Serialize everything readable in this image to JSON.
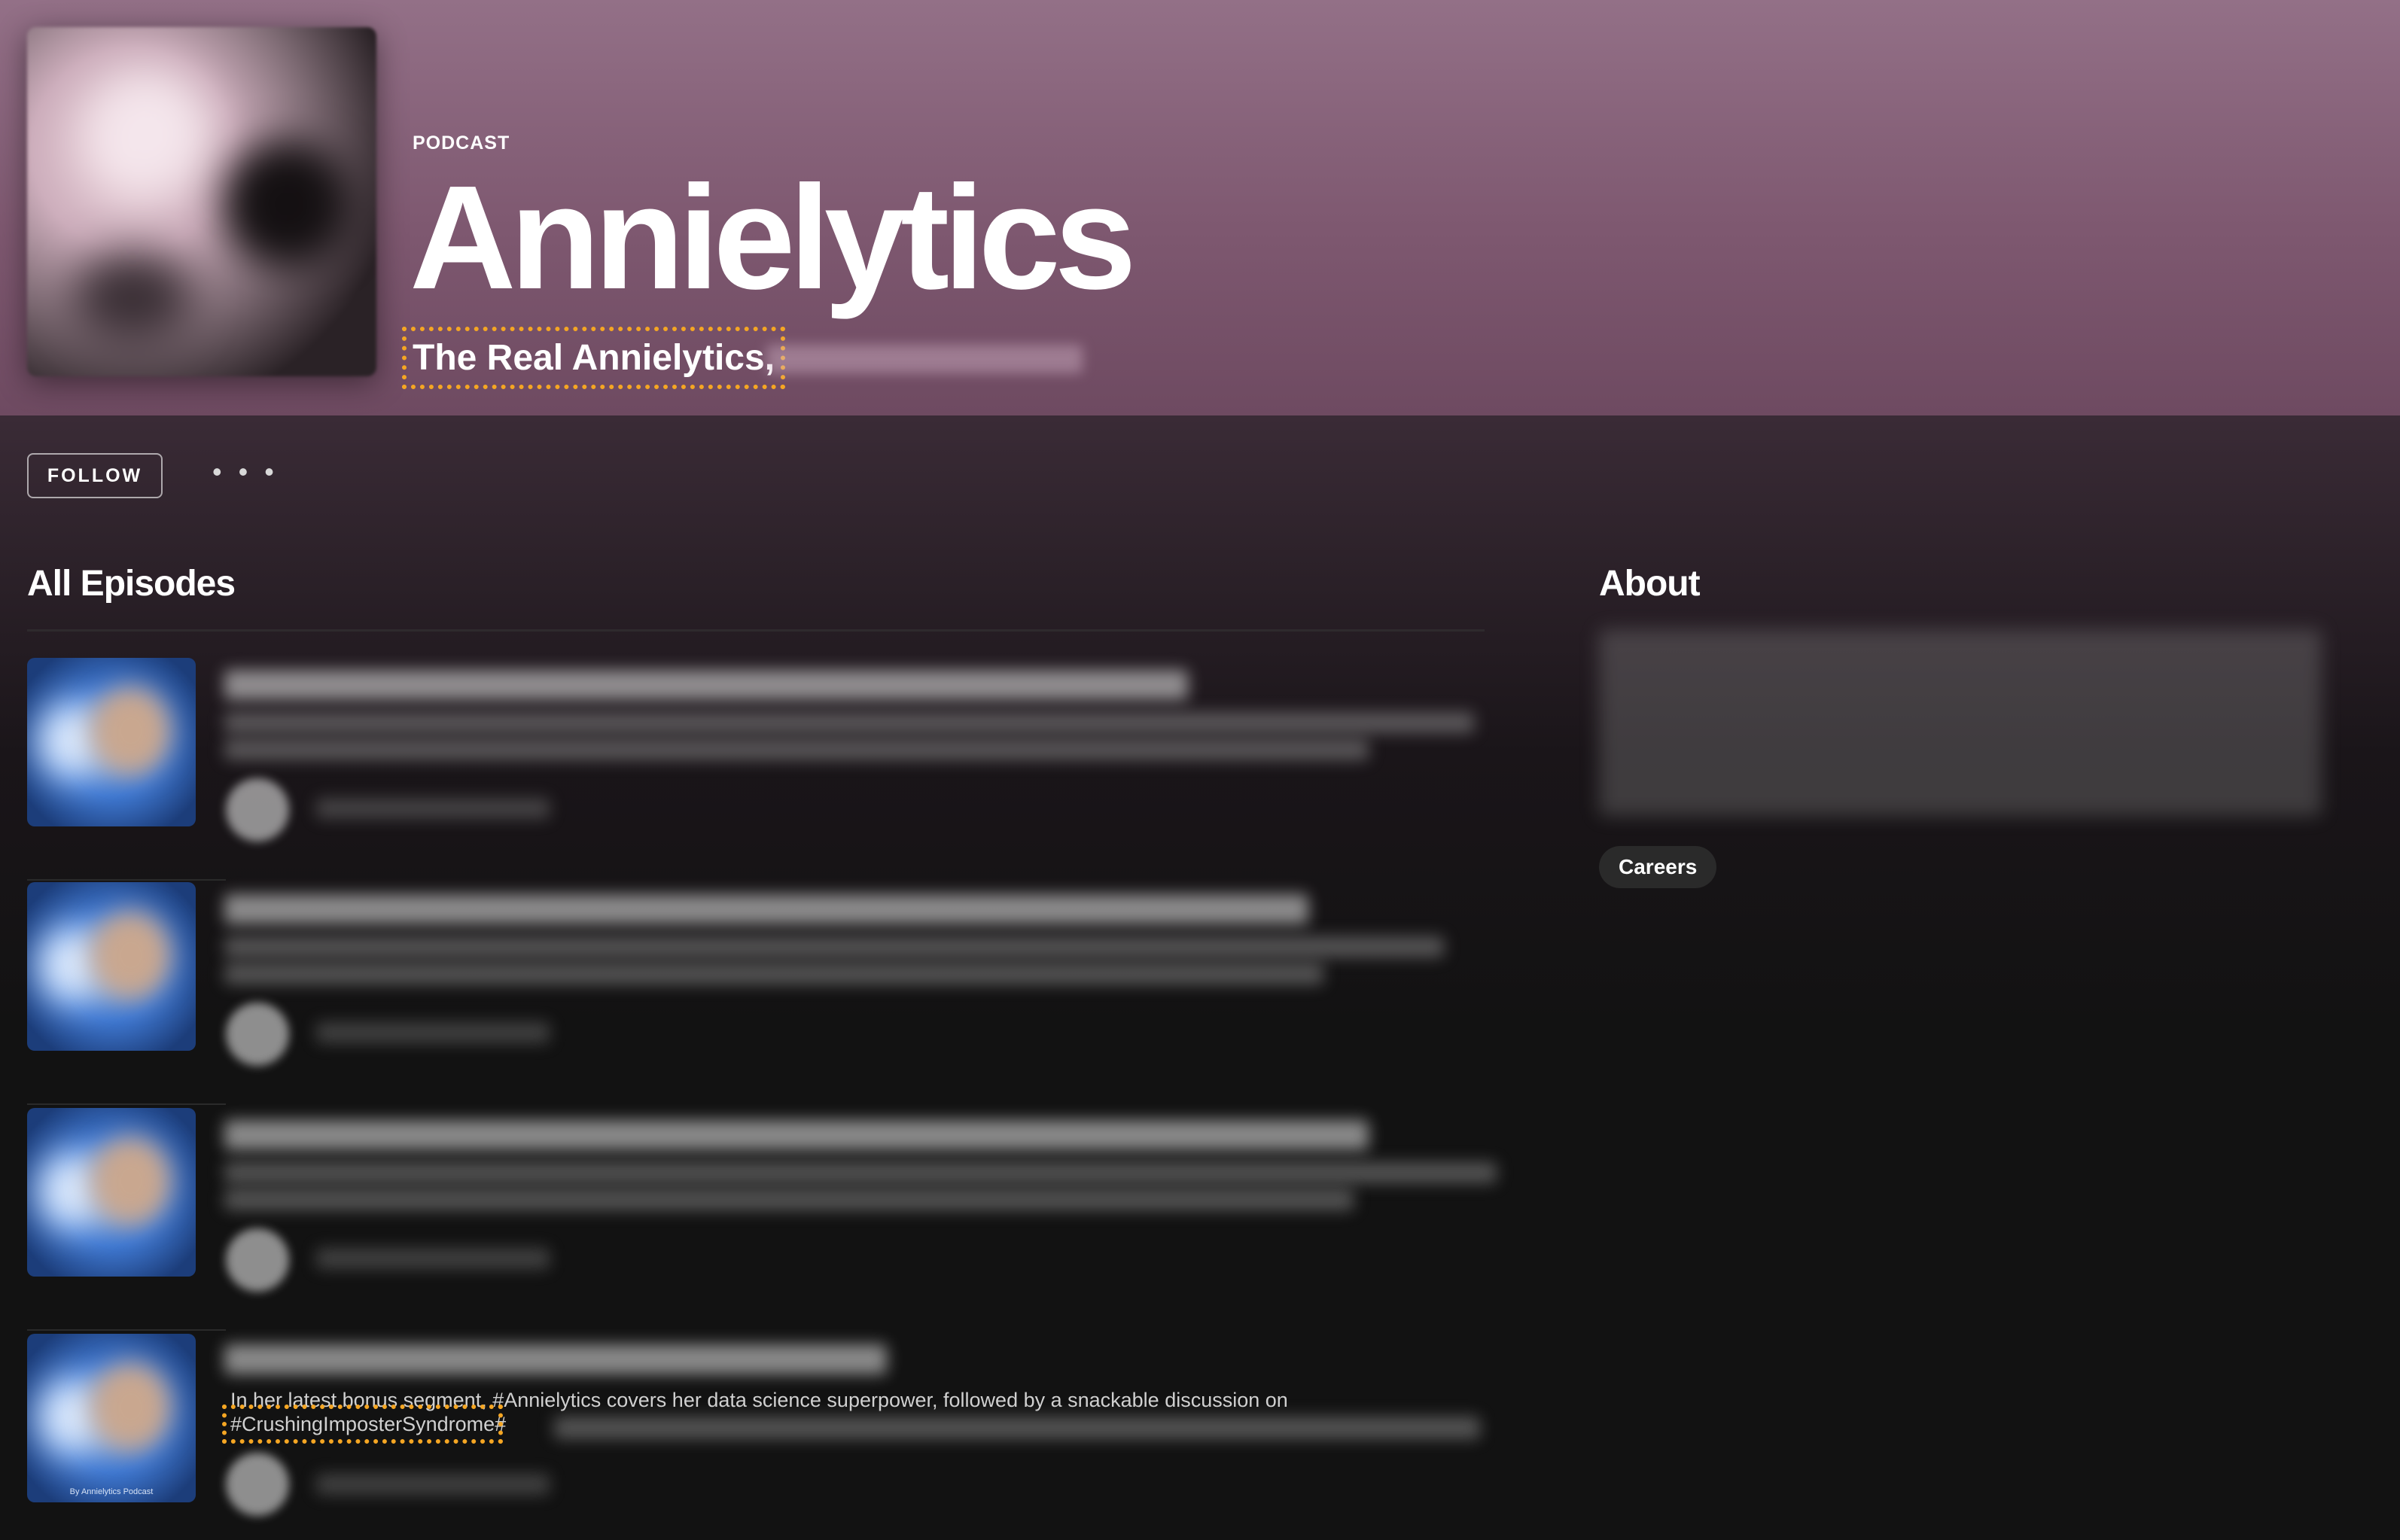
{
  "header": {
    "type_label": "PODCAST",
    "title": "Annielytics",
    "byline": "The Real Annielytics,"
  },
  "actions": {
    "follow_label": "FOLLOW",
    "more_label": "• • •"
  },
  "episodes_section": {
    "heading": "All Episodes",
    "visible_description": {
      "line1": "In her latest bonus segment, #Annielytics covers her data science superpower, followed by a snackable discussion on",
      "hashtag": "#CrushingImposterSyndrome",
      "trailing": "#"
    },
    "thumb_caption": "By Annielytics Podcast"
  },
  "about_section": {
    "heading": "About",
    "tag": "Careers"
  },
  "colors": {
    "hero_top": "#937087",
    "background": "#121212",
    "highlight_outline": "#f5a623"
  }
}
